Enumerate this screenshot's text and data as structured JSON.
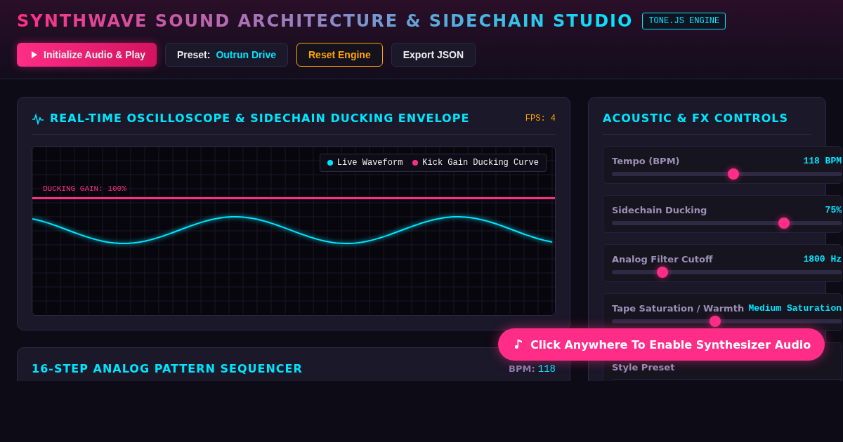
{
  "header": {
    "title": "SYNTHWAVE SOUND ARCHITECTURE & SIDECHAIN STUDIO",
    "engine_badge": "TONE.JS ENGINE"
  },
  "toolbar": [
    {
      "kind": "play",
      "label": "Initialize Audio & Play"
    },
    {
      "kind": "preset",
      "label": "Preset:",
      "value": "Outrun Drive"
    },
    {
      "kind": "reset",
      "label": "Reset Engine"
    },
    {
      "kind": "plain",
      "label": "Export JSON"
    }
  ],
  "oscilloscope": {
    "title": "REAL-TIME OSCILLOSCOPE & SIDECHAIN DUCKING ENVELOPE",
    "fps": "FPS: 4",
    "ducking_label": "DUCKING GAIN: 100%",
    "legend": [
      {
        "label": "Live Waveform",
        "color": "#00e5ff"
      },
      {
        "label": "Kick Gain Ducking Curve",
        "color": "#ff2d87"
      }
    ]
  },
  "sequencer": {
    "title": "16-STEP ANALOG PATTERN SEQUENCER",
    "bpm_label": "BPM:",
    "bpm_value": "118"
  },
  "controls": {
    "title": "ACOUSTIC & FX CONTROLS",
    "sliders": [
      {
        "label": "Tempo (BPM)",
        "reading": "118 BPM",
        "level": 0.53
      },
      {
        "label": "Sidechain Ducking",
        "reading": "75%",
        "level": 0.75
      },
      {
        "label": "Analog Filter Cutoff",
        "reading": "1800 Hz",
        "level": 0.22
      },
      {
        "label": "Tape Saturation / Warmth",
        "reading": "Medium Saturation",
        "level": 0.45
      }
    ],
    "style_preset_label": "Style Preset"
  },
  "toast": {
    "label": "Click Anywhere To Enable Synthesizer Audio"
  }
}
